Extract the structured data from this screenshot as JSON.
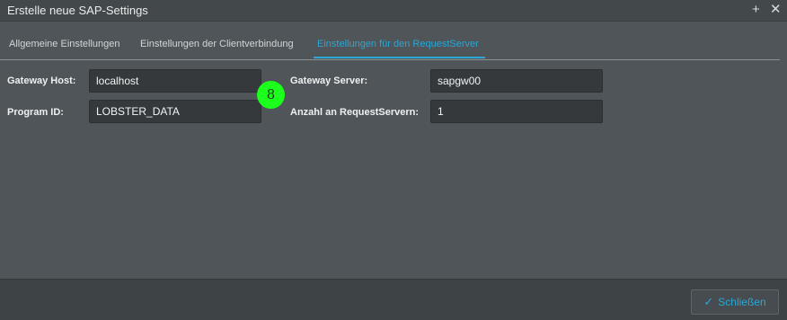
{
  "window": {
    "title": "Erstelle neue SAP-Settings",
    "plus_icon": "+",
    "close_icon": "✕"
  },
  "tabs": [
    {
      "label": "Allgemeine Einstellungen",
      "active": false
    },
    {
      "label": "Einstellungen der Clientverbindung",
      "active": false
    },
    {
      "label": "Einstellungen für den RequestServer",
      "active": true
    }
  ],
  "form": {
    "gateway_host": {
      "label": "Gateway Host:",
      "value": "localhost"
    },
    "program_id": {
      "label": "Program ID:",
      "value": "LOBSTER_DATA"
    },
    "gateway_server": {
      "label": "Gateway Server:",
      "value": "sapgw00"
    },
    "request_server_count": {
      "label": "Anzahl an RequestServern:",
      "value": "1"
    }
  },
  "badge": {
    "text": "8",
    "color": "#1cff1c"
  },
  "footer": {
    "close_label": "Schließen",
    "close_icon": "check-icon"
  },
  "colors": {
    "accent": "#2aa7d6",
    "background": "#4f5558"
  }
}
